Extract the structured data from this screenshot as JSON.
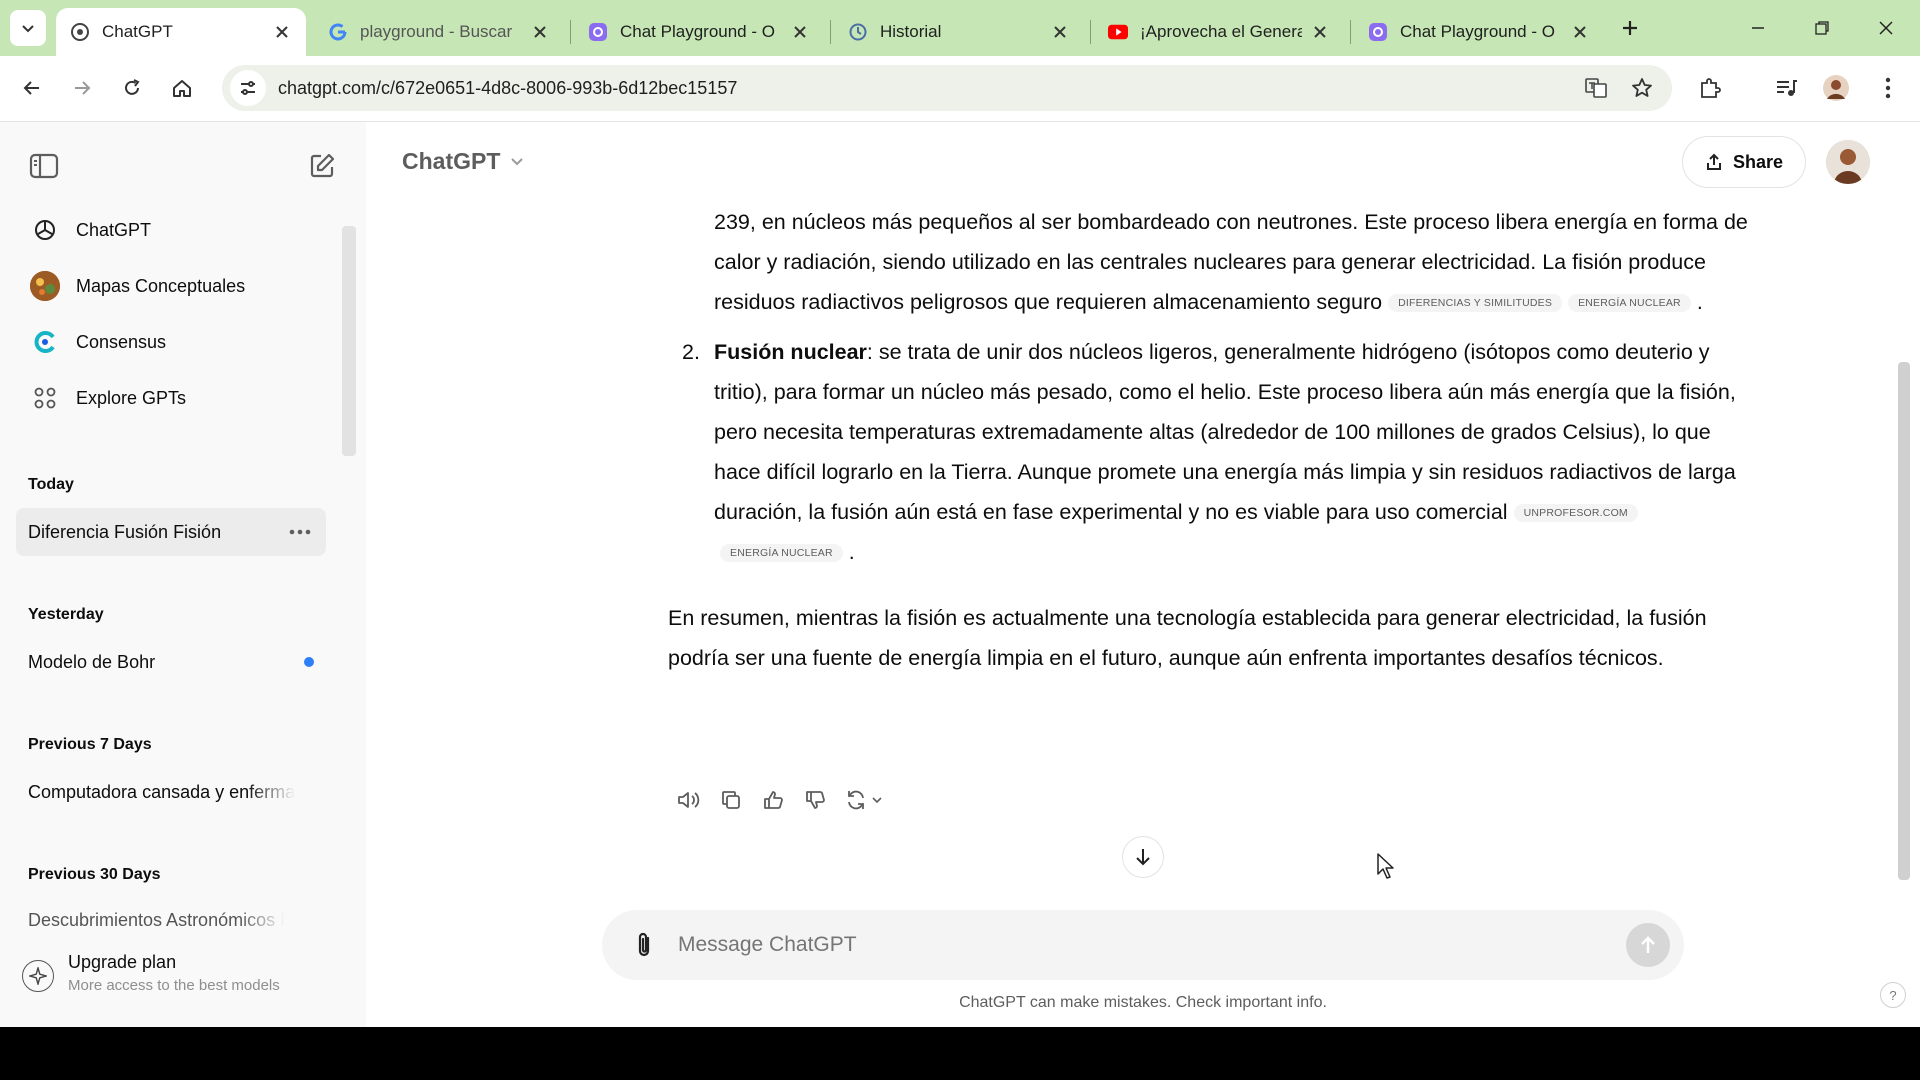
{
  "browser": {
    "tabs": [
      {
        "title": "ChatGPT",
        "icon": "openai-icon",
        "active": true
      },
      {
        "title": "playground - Buscar",
        "icon": "google-icon",
        "active": false
      },
      {
        "title": "Chat Playground - O",
        "icon": "playground-icon",
        "active": false
      },
      {
        "title": "Historial",
        "icon": "history-icon",
        "active": false
      },
      {
        "title": "¡Aprovecha el Genera",
        "icon": "youtube-icon",
        "active": false
      },
      {
        "title": "Chat Playground - O",
        "icon": "playground-icon",
        "active": false
      }
    ],
    "url": "chatgpt.com/c/672e0651-4d8c-8006-993b-6d12bec15157"
  },
  "sidebar": {
    "gpts": [
      {
        "label": "ChatGPT",
        "icon": "openai-icon"
      },
      {
        "label": "Mapas Conceptuales",
        "icon": "mapas-avatar-icon"
      },
      {
        "label": "Consensus",
        "icon": "consensus-icon"
      },
      {
        "label": "Explore GPTs",
        "icon": "grid-icon"
      }
    ],
    "sections": [
      {
        "title": "Today",
        "items": [
          {
            "label": "Diferencia Fusión Fisión",
            "active": true
          }
        ]
      },
      {
        "title": "Yesterday",
        "items": [
          {
            "label": "Modelo de Bohr",
            "unread": true
          }
        ]
      },
      {
        "title": "Previous 7 Days",
        "items": [
          {
            "label": "Computadora cansada y enferma"
          }
        ]
      },
      {
        "title": "Previous 30 Days",
        "items": [
          {
            "label": "Descubrimientos Astronómicos I"
          }
        ]
      }
    ],
    "upgrade": {
      "title": "Upgrade plan",
      "subtitle": "More access to the best models"
    }
  },
  "header": {
    "model": "ChatGPT",
    "share_label": "Share"
  },
  "message": {
    "item1_text": "239, en núcleos más pequeños al ser bombardeado con neutrones. Este proceso libera energía en forma de calor y radiación, siendo utilizado en las centrales nucleares para generar electricidad. La fisión produce residuos radiactivos peligrosos que requieren almacenamiento seguro",
    "item1_badges": [
      "DIFERENCIAS Y SIMILITUDES",
      "ENERGÍA NUCLEAR"
    ],
    "item2_num": "2.",
    "item2_bold": "Fusión nuclear",
    "item2_text": ": se trata de unir dos núcleos ligeros, generalmente hidrógeno (isótopos como deuterio y tritio), para formar un núcleo más pesado, como el helio. Este proceso libera aún más energía que la fisión, pero necesita temperaturas extremadamente altas (alrededor de 100 millones de grados Celsius), lo que hace difícil lograrlo en la Tierra. Aunque promete una energía más limpia y sin residuos radiactivos de larga duración, la fusión aún está en fase experimental y no es viable para uso comercial",
    "item2_badges": [
      "UNPROFESOR.COM",
      "ENERGÍA NUCLEAR"
    ],
    "summary": "En resumen, mientras la fisión es actualmente una tecnología establecida para generar electricidad, la fusión podría ser una fuente de energía limpia en el futuro, aunque aún enfrenta importantes desafíos técnicos."
  },
  "composer": {
    "placeholder": "Message ChatGPT"
  },
  "disclaimer": "ChatGPT can make mistakes. Check important info.",
  "help_label": "?",
  "colors": {
    "tabstrip": "#c6e7b5",
    "sidebar": "#f9f9f9",
    "unread_dot": "#2e7ef5",
    "youtube": "#ff0000"
  }
}
